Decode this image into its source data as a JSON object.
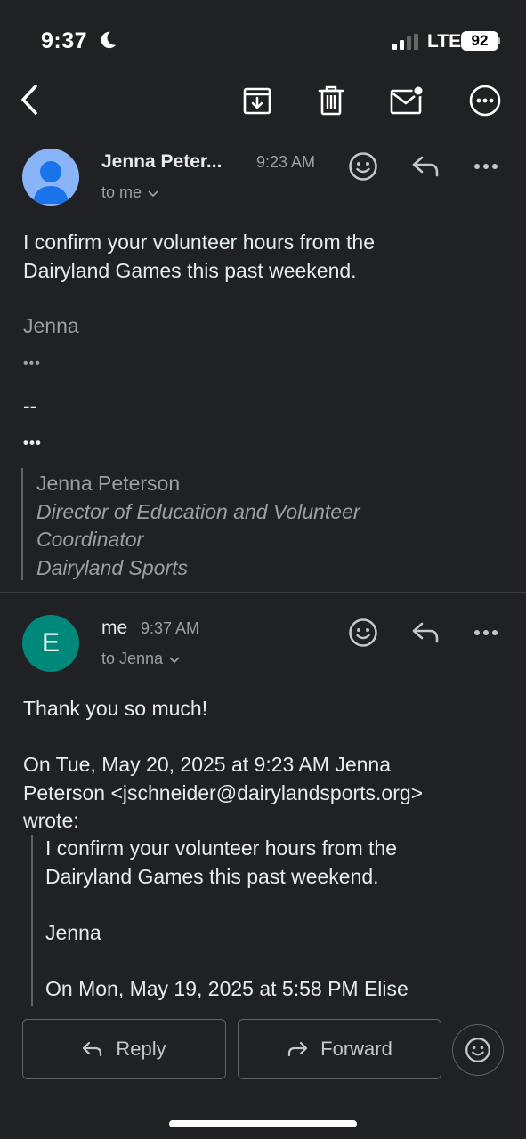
{
  "status_bar": {
    "time": "9:37",
    "network": "LTE",
    "battery": "92"
  },
  "toolbar": {
    "icons": [
      "back-icon",
      "archive-icon",
      "delete-icon",
      "mark-unread-icon",
      "more-icon"
    ]
  },
  "messages": [
    {
      "sender": "Jenna Peter...",
      "time": "9:23 AM",
      "recipient": "to me",
      "avatar_color": "#8ab4f8",
      "body": [
        "I confirm your volunteer hours from the",
        "Dairyland Games this past weekend."
      ],
      "signoff": "Jenna",
      "ellipsis_1": "•••",
      "separator": "--",
      "ellipsis_2": "•••",
      "signature": {
        "name": "Jenna Peterson",
        "title_1": "Director of Education and Volunteer",
        "title_2": "Coordinator",
        "org": "Dairyland Sports"
      }
    },
    {
      "sender": "me",
      "time": "9:37 AM",
      "recipient": "to Jenna",
      "avatar_letter": "E",
      "avatar_color": "#00897b",
      "body": "Thank you so much!",
      "attribution": [
        "On Tue, May 20, 2025 at 9:23 AM Jenna",
        "Peterson <jschneider@dairylandsports.org>",
        "wrote:"
      ],
      "quoted": [
        "I confirm your volunteer hours from the",
        "Dairyland Games this past weekend.",
        "Jenna",
        "On Mon, May 19, 2025 at 5:58 PM Elise"
      ]
    }
  ],
  "actions": {
    "reply": "Reply",
    "forward": "Forward"
  }
}
